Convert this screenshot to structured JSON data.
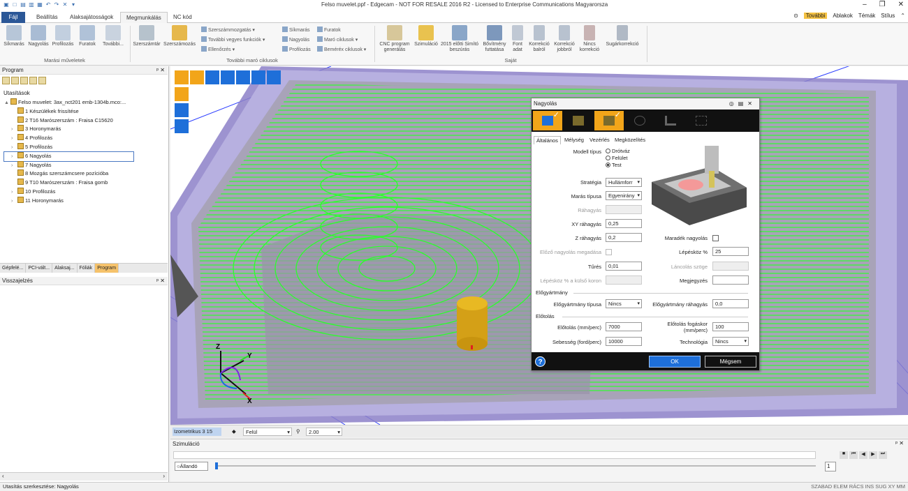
{
  "window": {
    "title": "Felso muvelet.ppf - Edgecam - NOT FOR RESALE 2016 R2 - Licensed to Enterprise Communications Magyarorsza"
  },
  "tabs": [
    "Fájl",
    "Beállítás",
    "Alaksajátosságok",
    "Megmunkálás",
    "NC kód"
  ],
  "tab_right": {
    "tovabbi": "További",
    "ablakok": "Ablakok",
    "temak": "Témák",
    "stilus": "Stílus"
  },
  "ribbon": {
    "group1": {
      "label": "Marási műveletek",
      "buttons": [
        "Síkmarás",
        "Nagyolás",
        "Profilozás",
        "Furatok",
        "További..."
      ]
    },
    "group2": {
      "label": "További maró ciklusok",
      "buttons": [
        "Szerszámtár",
        "Szerszámozás"
      ],
      "small_col1": [
        "Szerszámmozgatás",
        "További vegyes funkciók",
        "Ellenőrzés"
      ],
      "small_col2": [
        "Síkmarás",
        "Nagyolás",
        "Profilozás"
      ],
      "small_col3": [
        "Furatok",
        "Maró ciklusok",
        "Beméréx ciklusok"
      ]
    },
    "group3": {
      "label": "Saját",
      "buttons": [
        "CNC program generálás",
        "Szimuláció",
        "2015 előtti Simító beszúrás",
        "Bővítmény futtatása",
        "Font adat",
        "Korrekció balról",
        "Korrekció jobbról",
        "Nincs korrekció",
        "Sugárkorrekció"
      ]
    }
  },
  "program_panel": {
    "title": "Program",
    "section": "Utasítások",
    "tree": [
      {
        "label": "Felso muvelet: 3ax_nct201 emb-1304b.mco:...",
        "level": 0,
        "expander": "▲"
      },
      {
        "label": "1 Készülékek frissítése",
        "level": 1,
        "expander": ""
      },
      {
        "label": "2 T16 Marószerszám : Fraisa C15620",
        "level": 1,
        "expander": ""
      },
      {
        "label": "3 Horonymarás",
        "level": 1,
        "expander": "›"
      },
      {
        "label": "4 Profilozás",
        "level": 1,
        "expander": "›"
      },
      {
        "label": "5 Profilozás",
        "level": 1,
        "expander": "›"
      },
      {
        "label": "6 Nagyolás",
        "level": 1,
        "expander": "›",
        "selected": true
      },
      {
        "label": "7 Nagyolás",
        "level": 1,
        "expander": "›"
      },
      {
        "label": "8 Mozgás szerszámcsere pozícióba",
        "level": 1,
        "expander": ""
      },
      {
        "label": "9 T10 Marószerszám : Fraisa gomb",
        "level": 1,
        "expander": ""
      },
      {
        "label": "10 Profilozás",
        "level": 1,
        "expander": "›"
      },
      {
        "label": "11 Horonymarás",
        "level": 1,
        "expander": "›"
      }
    ],
    "bottom_tabs": [
      "Gépfelé...",
      "PCI-vált...",
      "Alaksaj...",
      "Fóliák",
      "Program"
    ]
  },
  "feedback_panel": {
    "title": "Visszajelzés"
  },
  "view_status": {
    "view_name": "Izometrikus 3 15",
    "view_mode": "Felül",
    "zoom": "2.00"
  },
  "axes": {
    "z": "Z",
    "y": "Y",
    "x": "X"
  },
  "simulation": {
    "title": "Szimuláció",
    "mode_button": "Állandó",
    "counter": "1"
  },
  "statusbar": {
    "left": "Utasítás szerkesztése: Nagyolás",
    "right": "SZABAD ELEM RÁCS INS SUG XY MM"
  },
  "dialog": {
    "title": "Nagyolás",
    "tabs": [
      "Általános",
      "Mélység",
      "Vezérlés",
      "Megközelítés"
    ],
    "model_type_label": "Modell típus",
    "model_types": [
      "Drótváz",
      "Felület",
      "Test"
    ],
    "model_type_selected": 2,
    "fields": {
      "strategia": {
        "label": "Stratégia",
        "value": "Hullámforr"
      },
      "maras_tipusa": {
        "label": "Marás típusa",
        "value": "Egyenirány"
      },
      "rahagyas": {
        "label": "Ráhagyás",
        "value": ""
      },
      "xy_rahagyas": {
        "label": "XY ráhagyás",
        "value": "0,25"
      },
      "z_rahagyas": {
        "label": "Z ráhagyás",
        "value": "0,2"
      },
      "maradek_nagyolas": {
        "label": "Maradék nagyolás"
      },
      "elozo_nagyolas": {
        "label": "Előző nagyolás megadása"
      },
      "lepeskoz": {
        "label": "Lépésköz %",
        "value": "25"
      },
      "tures": {
        "label": "Tűrés",
        "value": "0,01"
      },
      "lancolas_szoge": {
        "label": "Láncolás szöge",
        "value": ""
      },
      "lepeskoz_kulso": {
        "label": "Lépésköz % a külső koron",
        "value": ""
      },
      "megjegyzes": {
        "label": "Megjegyzés",
        "value": ""
      }
    },
    "section_elogyartmany": "Előgyártmány",
    "elogyartmany_tipusa": {
      "label": "Előgyártmány típusa",
      "value": "Nincs"
    },
    "elogyartmany_rahagyas": {
      "label": "Előgyártmány ráhagyás",
      "value": "0,0"
    },
    "section_elotolas": "Előtolás",
    "elotolas": {
      "label": "Előtolás (mm/perc)",
      "value": "7000"
    },
    "elotolas_fogaskor": {
      "label1": "Előtolás fogáskor",
      "label2": "(mm/perc)",
      "value": "100"
    },
    "sebesseg": {
      "label": "Sebesség (ford/perc)",
      "value": "10000"
    },
    "technologia": {
      "label": "Technológia",
      "value": "Nincs"
    },
    "ok": "OK",
    "cancel": "Mégsem",
    "help": "?"
  },
  "colors": {
    "accent": "#2b5797",
    "orange": "#f2a51a",
    "toolpath": "#2bff2b",
    "part": "#9a8fd0"
  }
}
